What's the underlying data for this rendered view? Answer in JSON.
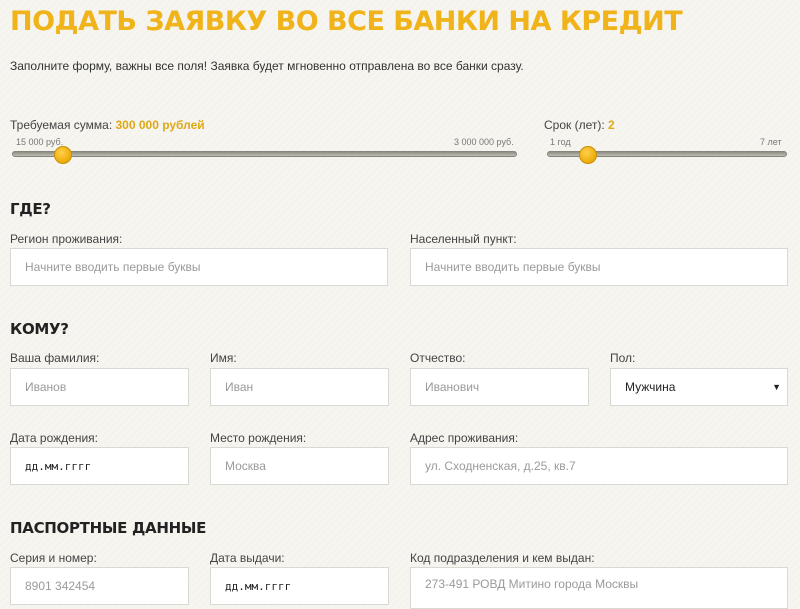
{
  "header": {
    "title": "ПОДАТЬ ЗАЯВКУ ВО ВСЕ БАНКИ НА КРЕДИТ",
    "intro": "Заполните форму, важны все поля! Заявка будет мгновенно отправлена во все банки сразу."
  },
  "amount_slider": {
    "label": "Требуемая сумма:",
    "value_text": "300 000 рублей",
    "min_label": "15 000 руб.",
    "max_label": "3 000 000 руб.",
    "fraction": 0.1
  },
  "term_slider": {
    "label": "Срок (лет):",
    "value_text": "2",
    "min_label": "1 год",
    "max_label": "7 лет",
    "fraction": 0.17
  },
  "where": {
    "heading": "ГДЕ?",
    "region": {
      "label": "Регион проживания:",
      "placeholder": "Начните вводить первые буквы"
    },
    "city": {
      "label": "Населенный пункт:",
      "placeholder": "Начните вводить первые буквы"
    }
  },
  "whom": {
    "heading": "КОМУ?",
    "surname": {
      "label": "Ваша фамилия:",
      "placeholder": "Иванов"
    },
    "name": {
      "label": "Имя:",
      "placeholder": "Иван"
    },
    "patronymic": {
      "label": "Отчество:",
      "placeholder": "Иванович"
    },
    "gender": {
      "label": "Пол:",
      "value": "Мужчина"
    },
    "birth_date": {
      "label": "Дата рождения:",
      "placeholder": "дд.мм.гггг"
    },
    "birth_place": {
      "label": "Место рождения:",
      "placeholder": "Москва"
    },
    "address": {
      "label": "Адрес проживания:",
      "placeholder": "ул. Сходненская, д.25, кв.7"
    }
  },
  "passport": {
    "heading": "ПАСПОРТНЫЕ ДАННЫЕ",
    "series": {
      "label": "Серия и номер:",
      "placeholder": "8901 342454"
    },
    "issue_date": {
      "label": "Дата выдачи:",
      "placeholder": "дд.мм.гггг"
    },
    "issuer": {
      "label": "Код подразделения и кем выдан:",
      "placeholder": "273-491 РОВД Митино города Москвы"
    }
  }
}
